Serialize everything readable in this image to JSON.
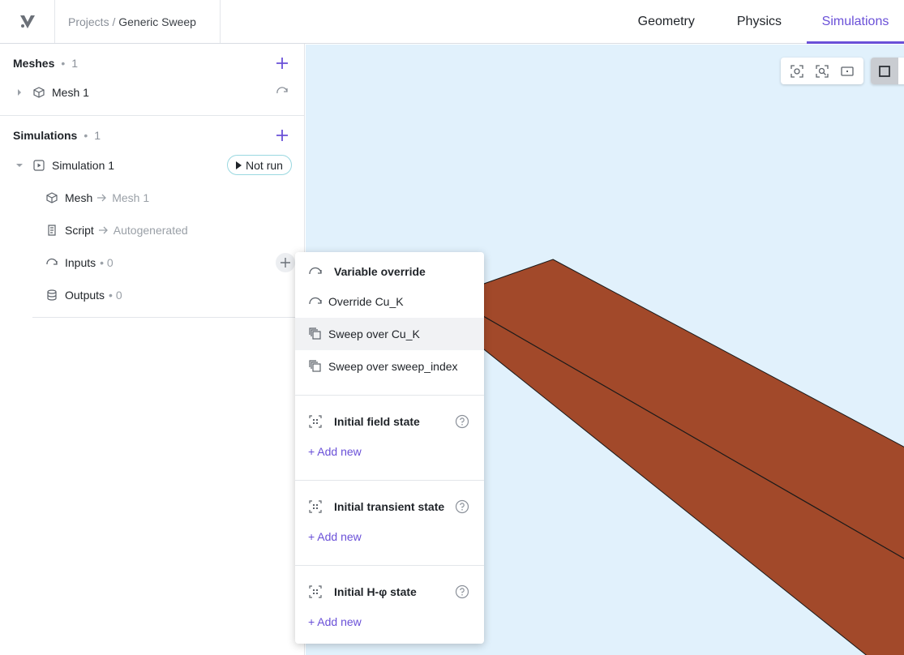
{
  "header": {
    "breadcrumb_root": "Projects",
    "breadcrumb_sep": " / ",
    "breadcrumb_current": "Generic Sweep",
    "tabs": [
      {
        "label": "Geometry",
        "active": false
      },
      {
        "label": "Physics",
        "active": false
      },
      {
        "label": "Simulations",
        "active": true
      }
    ]
  },
  "sidebar": {
    "meshes": {
      "title": "Meshes",
      "dot": "•",
      "count": "1",
      "items": [
        {
          "label": "Mesh 1"
        }
      ]
    },
    "simulations": {
      "title": "Simulations",
      "dot": "•",
      "count": "1",
      "item": {
        "label": "Simulation 1",
        "status": "Not run",
        "children": {
          "mesh": {
            "label": "Mesh",
            "target": "Mesh 1"
          },
          "script": {
            "label": "Script",
            "target": "Autogenerated"
          },
          "inputs": {
            "label": "Inputs",
            "count": "• 0"
          },
          "outputs": {
            "label": "Outputs",
            "count": "• 0"
          }
        }
      }
    }
  },
  "menu": {
    "variable_override": {
      "title": "Variable override",
      "items": [
        {
          "label": "Override Cu_K",
          "icon": "override-icon"
        },
        {
          "label": "Sweep over Cu_K",
          "icon": "sweep-icon",
          "highlighted": true
        },
        {
          "label": "Sweep over sweep_index",
          "icon": "sweep-icon"
        }
      ]
    },
    "initial_field_state": {
      "title": "Initial field state",
      "add": "+ Add new"
    },
    "initial_transient_state": {
      "title": "Initial transient state",
      "add": "+ Add new"
    },
    "initial_h_phi_state": {
      "title": "Initial H-φ state",
      "add": "+ Add new"
    }
  },
  "colors": {
    "accent": "#6a50d8",
    "viewport_bg": "#e1f1fc",
    "geometry_fill": "#a2492a",
    "badge_border": "#9ad8e0"
  }
}
